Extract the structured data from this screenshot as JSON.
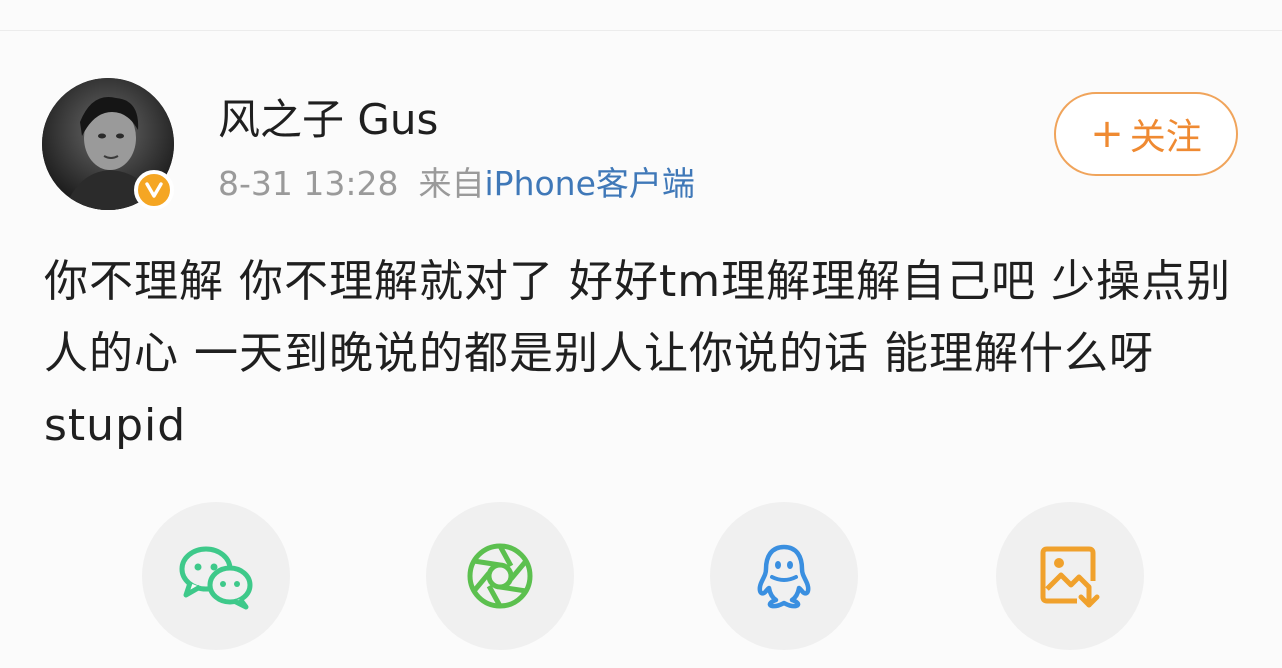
{
  "post": {
    "author": "风之子 Gus",
    "date": "8-31 13:28",
    "source_prefix": "来自",
    "source_device": "iPhone客户端",
    "follow_label": "关注",
    "follow_plus": "+",
    "text": "你不理解 你不理解就对了 好好tm理解理解自己吧 少操点别人的心 一天到晚说的都是别人让你说的话 能理解什么呀 stupid"
  },
  "share": {
    "buttons": [
      "wechat-icon",
      "moments-icon",
      "qq-icon",
      "save-image-icon"
    ]
  },
  "colors": {
    "accent_orange": "#ef8a32",
    "verified_badge": "#f5a623",
    "link_blue": "#3f78b8",
    "wechat_green": "#3ec98a",
    "moments_green": "#5cc04f",
    "qq_blue": "#3a8fe0",
    "save_orange": "#f0a12c"
  }
}
